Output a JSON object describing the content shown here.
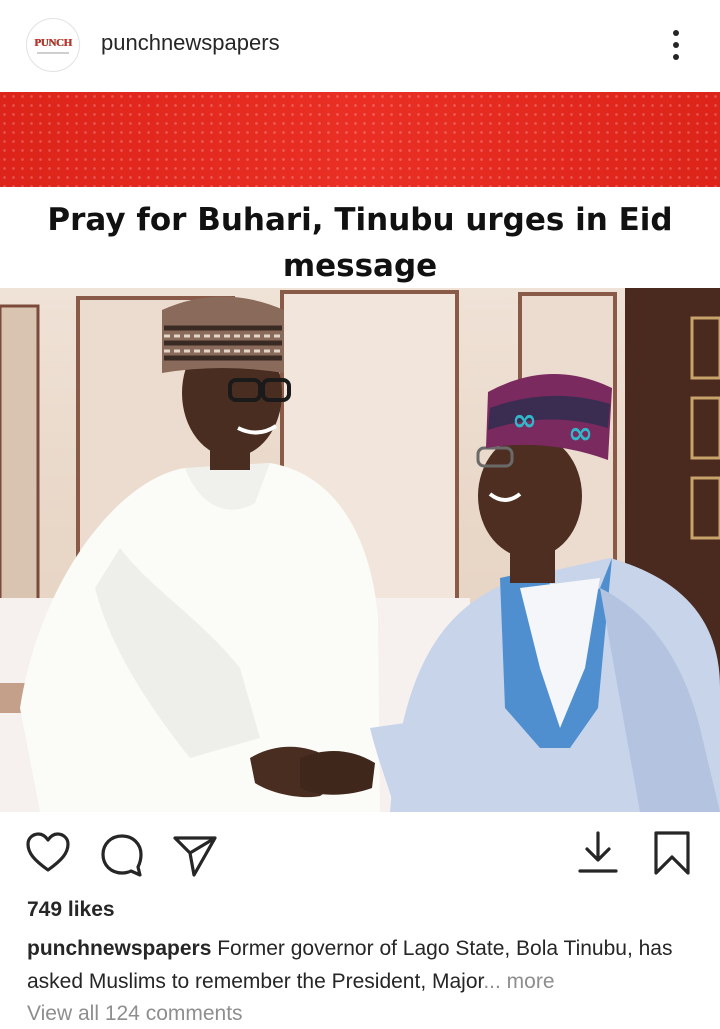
{
  "header": {
    "avatar_text": "PUNCH",
    "username": "punchnewspapers",
    "more_icon": "more-vertical-icon"
  },
  "post": {
    "headline": "Pray for Buhari, Tinubu urges in Eid message",
    "brand_color": "#e9261b"
  },
  "actions": {
    "like_icon": "heart-icon",
    "comment_icon": "comment-icon",
    "share_icon": "send-icon",
    "download_icon": "download-icon",
    "save_icon": "bookmark-icon"
  },
  "footer": {
    "likes": "749 likes",
    "caption_user": "punchnewspapers",
    "caption_text": " Former governor of Lago State, Bola Tinubu, has asked Muslims to remember the President, Major",
    "caption_more": "... more",
    "view_comments": "View all 124 comments"
  }
}
